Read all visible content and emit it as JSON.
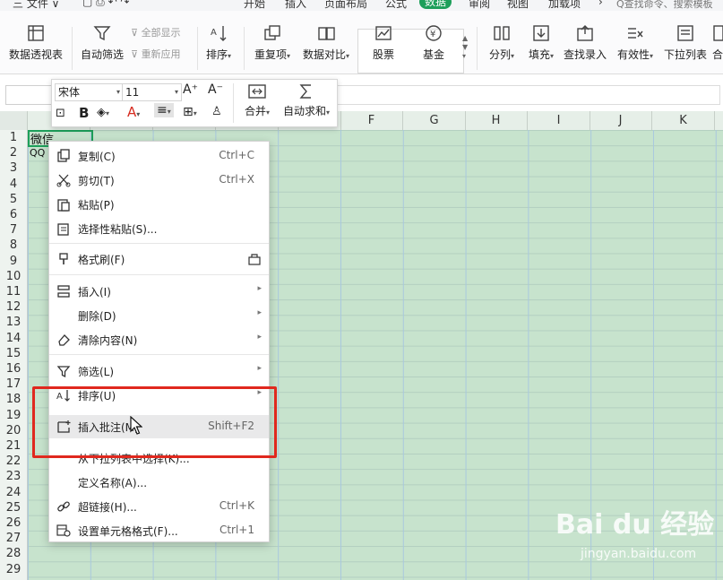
{
  "menubar": {
    "left_items": [
      "三 文件 ∨"
    ],
    "tabs": [
      "开始",
      "插入",
      "页面布局",
      "公式",
      "数据",
      "审阅",
      "视图",
      "加载项"
    ],
    "active_tab": "数据",
    "search_placeholder": "Q查找命令、搜索模板"
  },
  "ribbon": {
    "pivot": "数据透视表",
    "autofilter": "自动筛选",
    "show_all": "全部显示",
    "reapply": "重新应用",
    "sort": "排序",
    "duplicates": "重复项",
    "compare": "数据对比",
    "stock": "股票",
    "fund": "基金",
    "split": "分列",
    "fill": "填充",
    "lookup": "查找录入",
    "validity": "有效性",
    "dropdown": "下拉列表",
    "more": "合"
  },
  "mini_toolbar": {
    "font_name": "宋体",
    "font_size": "11",
    "merge": "合并",
    "autosum": "自动求和",
    "bold": "B"
  },
  "grid": {
    "columns": [
      "F",
      "G",
      "H",
      "I",
      "J",
      "K"
    ],
    "rows": [
      "1",
      "2",
      "3",
      "4",
      "5",
      "6",
      "7",
      "8",
      "9",
      "10",
      "11",
      "12",
      "13",
      "14",
      "15",
      "16",
      "17",
      "18",
      "19",
      "20",
      "21",
      "22",
      "23",
      "24",
      "25",
      "26",
      "27",
      "28",
      "29"
    ],
    "cells": {
      "A1": "微信",
      "A2": "QQ"
    }
  },
  "context_menu": {
    "copy": {
      "label": "复制(C)",
      "shortcut": "Ctrl+C"
    },
    "cut": {
      "label": "剪切(T)",
      "shortcut": "Ctrl+X"
    },
    "paste": {
      "label": "粘贴(P)"
    },
    "paste_special": {
      "label": "选择性粘贴(S)..."
    },
    "format_painter": {
      "label": "格式刷(F)"
    },
    "insert": {
      "label": "插入(I)"
    },
    "delete": {
      "label": "删除(D)"
    },
    "clear": {
      "label": "清除内容(N)"
    },
    "filter": {
      "label": "筛选(L)"
    },
    "sort": {
      "label": "排序(U)"
    },
    "insert_comment": {
      "label": "插入批注(M)",
      "shortcut": "Shift+F2"
    },
    "pick_from_list": {
      "label": "从下拉列表中选择(K)..."
    },
    "define_name": {
      "label": "定义名称(A)..."
    },
    "hyperlink": {
      "label": "超链接(H)...",
      "shortcut": "Ctrl+K"
    },
    "format_cells": {
      "label": "设置单元格格式(F)...",
      "shortcut": "Ctrl+1"
    }
  },
  "watermark": {
    "brand": "Bai du 经验",
    "url": "jingyan.baidu.com"
  },
  "colors": {
    "accent": "#1d9f5a",
    "sheet_bg": "#c7e3cd",
    "highlight_box": "#e0281e"
  }
}
